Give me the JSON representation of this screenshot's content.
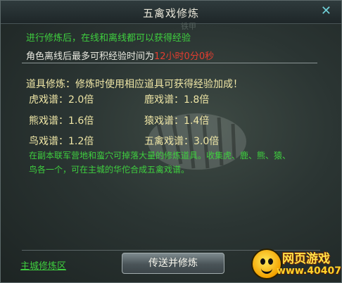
{
  "window": {
    "title": "五禽戏修炼",
    "close_glyph": "✕"
  },
  "info": {
    "line1": "进行修炼后，在线和离线都可以获得经验",
    "line2_prefix": "角色离线后最多可积经验时间为",
    "line2_value": "12小时0分0秒",
    "faint_text": "铁甲"
  },
  "items": {
    "heading": "道具修炼：修炼时使用相应道具可获得经验加成！",
    "multipliers": [
      {
        "name": "虎戏谱：",
        "value": "2.0倍"
      },
      {
        "name": "鹿戏谱：",
        "value": "1.8倍"
      },
      {
        "name": "熊戏谱：",
        "value": "1.6倍"
      },
      {
        "name": "猿戏谱：",
        "value": "1.4倍"
      },
      {
        "name": "鸟戏谱：",
        "value": "1.2倍"
      },
      {
        "name": "五禽戏谱：",
        "value": "3.0倍"
      }
    ],
    "note_line1": "在副本联军营地和蛮穴可掉落大量的修炼道具。收集虎、鹿、熊、猿、",
    "note_line2": "鸟各一个，可在主城的华佗合成五禽戏谱。"
  },
  "footer": {
    "link_label": "主城修炼区",
    "button_label": "传送并修炼"
  },
  "watermark": {
    "text1": "网页游戏",
    "text2": "www.40407.com"
  },
  "colors": {
    "green_text": "#3fcf3f",
    "red_value": "#e53d2f",
    "yellow_text": "#efe6a6"
  }
}
